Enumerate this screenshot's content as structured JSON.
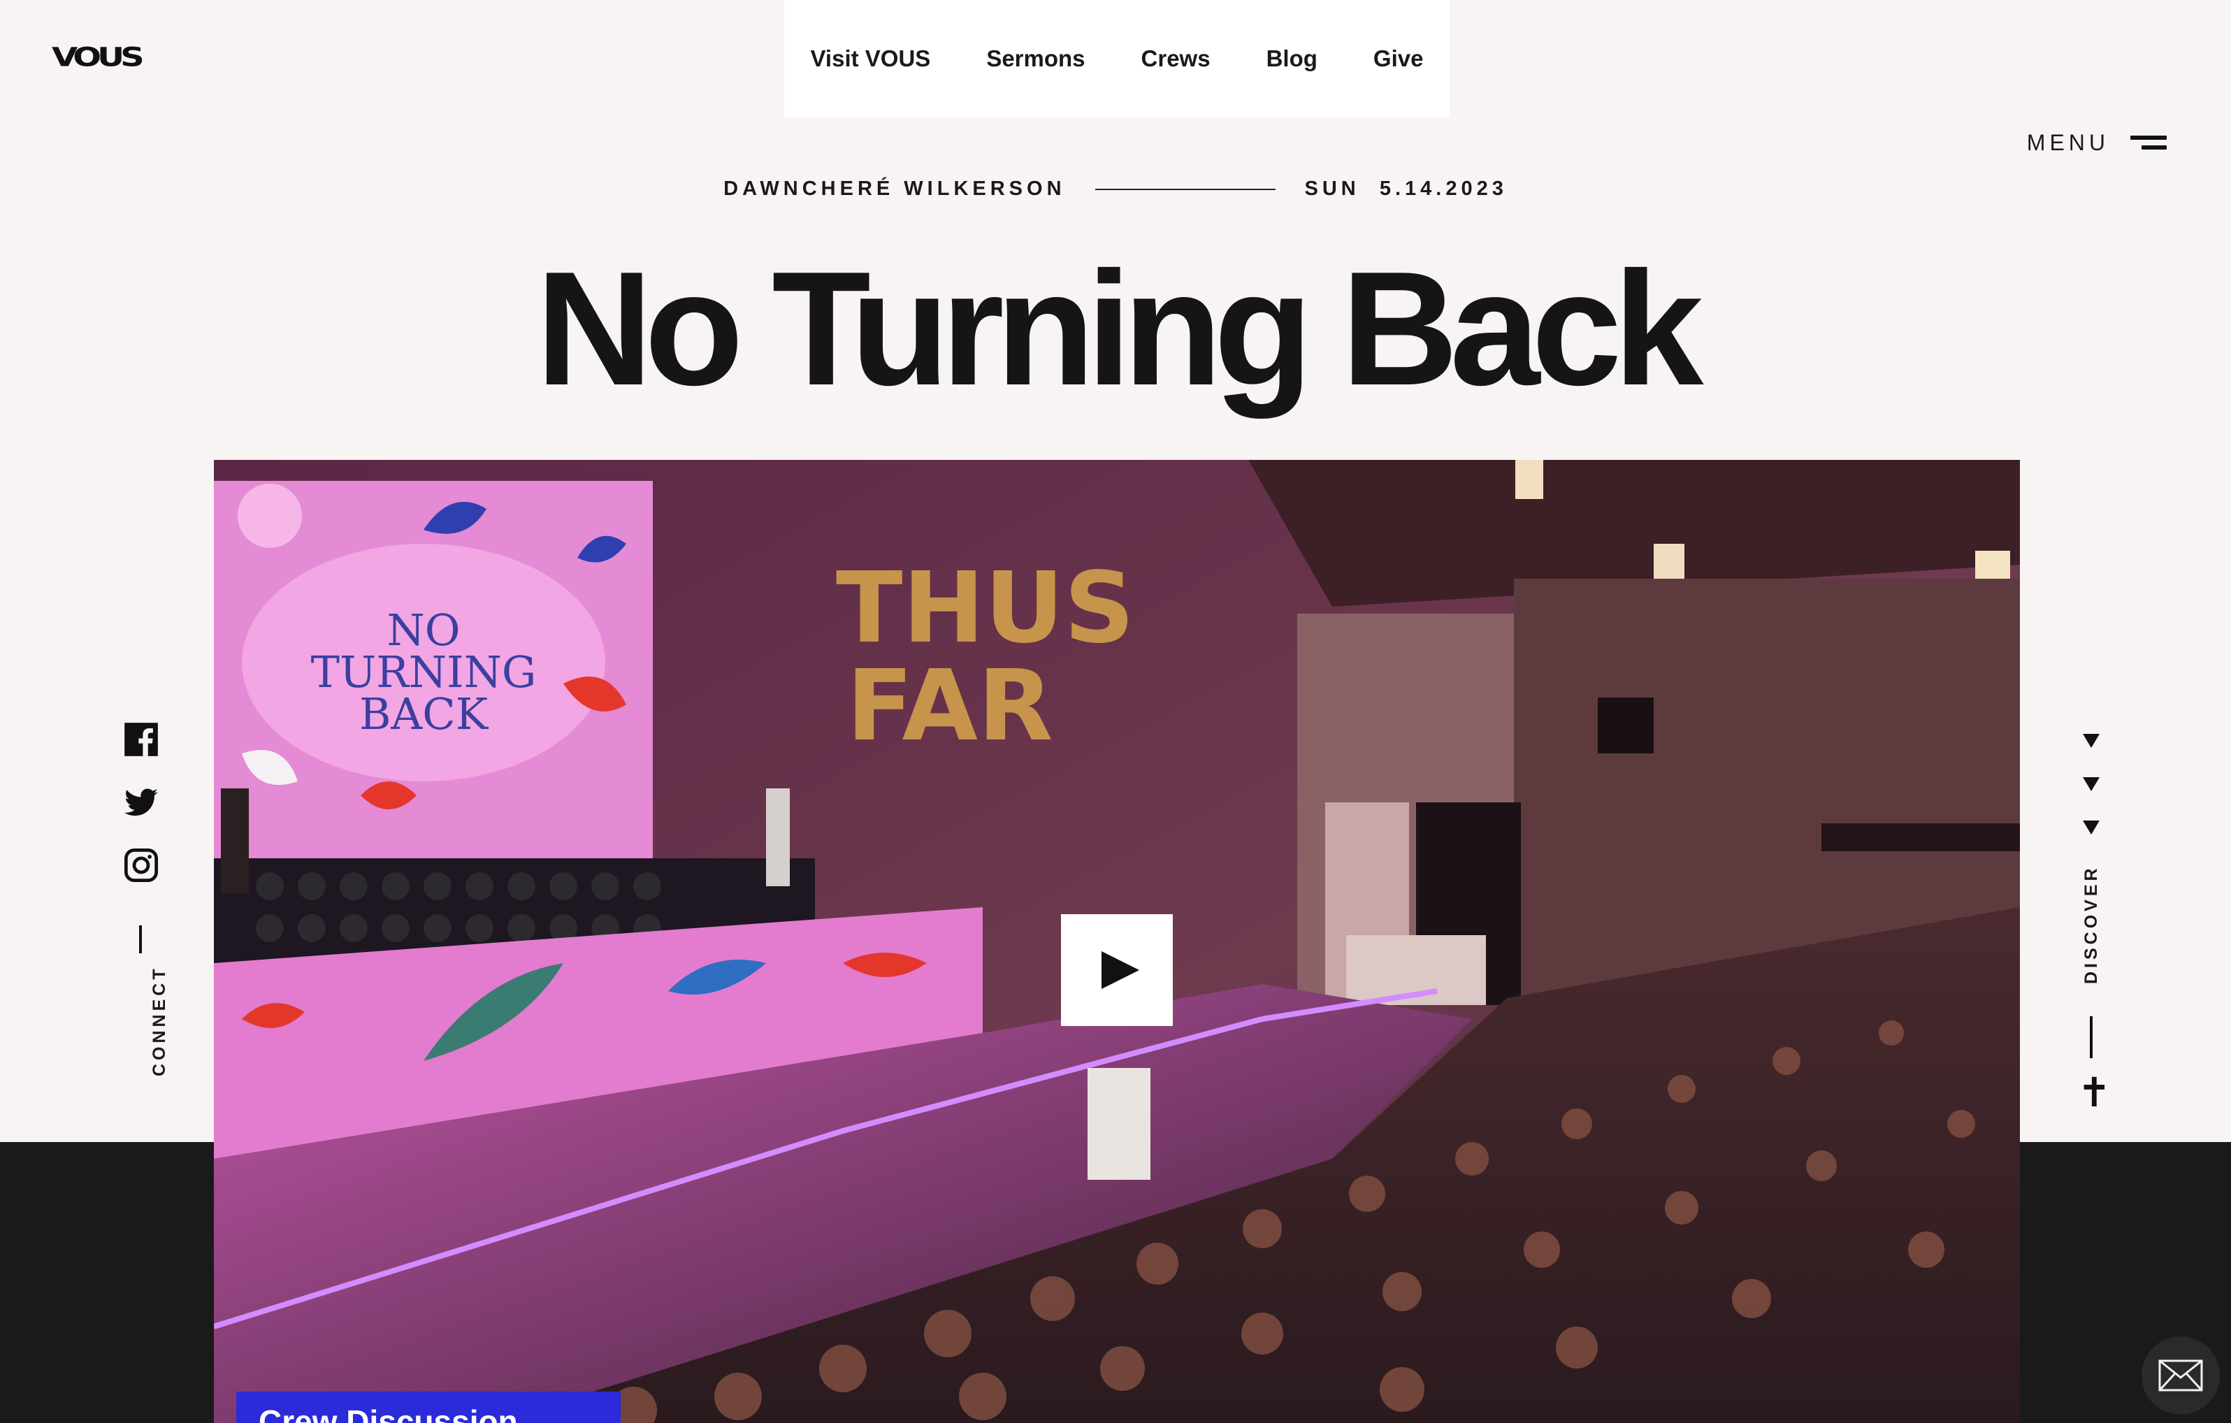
{
  "brand": {
    "logo": "VOUS"
  },
  "nav": {
    "items": [
      "Visit VOUS",
      "Sermons",
      "Crews",
      "Blog",
      "Give"
    ]
  },
  "menu": {
    "label": "MENU"
  },
  "sermon": {
    "speaker": "DAWNCHERÉ WILKERSON",
    "date": "SUN  5.14.2023",
    "title": "No Turning Back"
  },
  "video": {
    "screen_text": [
      "NO",
      "TURNING",
      "BACK"
    ],
    "wall_text": [
      "THUS",
      "FAR"
    ],
    "play_icon": "play-icon",
    "crew_button_label": "Crew Discussion →"
  },
  "social": {
    "label": "CONNECT",
    "icons": [
      "facebook-icon",
      "twitter-icon",
      "instagram-icon"
    ]
  },
  "discover": {
    "label": "DISCOVER",
    "icons": [
      "chevron-down-icon",
      "cross-icon"
    ]
  },
  "mail": {
    "icon": "mail-icon"
  },
  "colors": {
    "background": "#f7f4f3",
    "dark_band": "#1b1a1b",
    "accent_blue": "#2b2bd9",
    "nav_bg": "#ffffff"
  }
}
